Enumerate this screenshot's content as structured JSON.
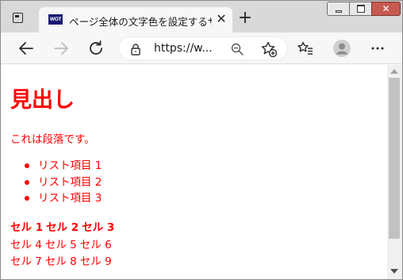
{
  "browser": {
    "tab": {
      "favicon_text": "WOT",
      "title": "ページ全体の文字色を設定するサンプル",
      "close_glyph": "✕"
    },
    "new_tab_glyph": "+",
    "address": {
      "url": "https://w..."
    },
    "window_buttons": {
      "close_glyph": "✕"
    },
    "icons": [
      "tab-actions-icon",
      "back-icon",
      "forward-icon",
      "reload-icon",
      "lock-icon",
      "zoom-icon",
      "add-favorite-icon",
      "favorites-icon",
      "profile-icon",
      "more-icon"
    ]
  },
  "page": {
    "text_color": "#ff0000",
    "heading": "見出し",
    "paragraph": "これは段落です。",
    "list_items": [
      "リスト項目 1",
      "リスト項目 2",
      "リスト項目 3"
    ],
    "table": {
      "header": [
        "セル 1",
        "セル 2",
        "セル 3"
      ],
      "rows": [
        [
          "セル 4",
          "セル 5",
          "セル 6"
        ],
        [
          "セル 7",
          "セル 8",
          "セル 9"
        ]
      ]
    }
  }
}
